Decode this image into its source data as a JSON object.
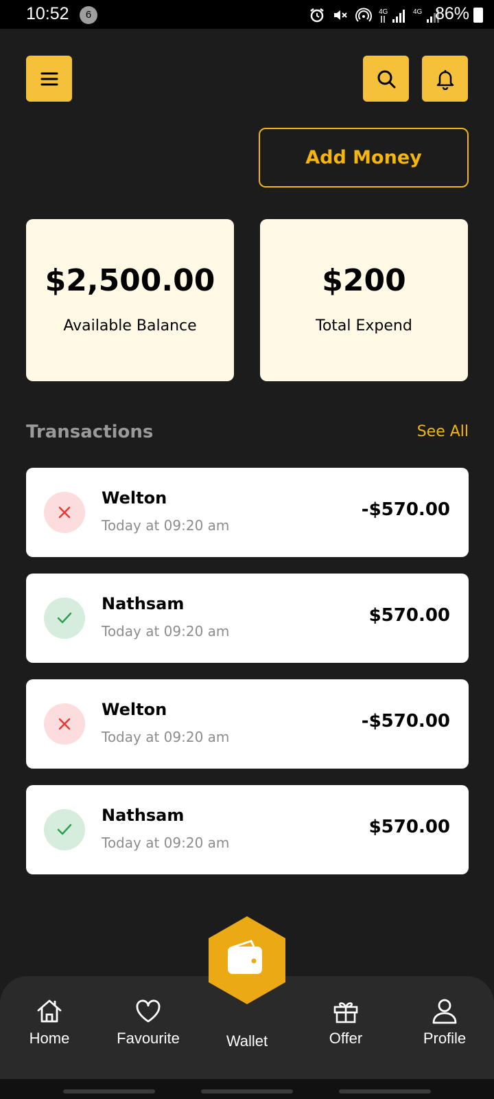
{
  "status_bar": {
    "time": "10:52",
    "notification_count": "6",
    "battery": "86%"
  },
  "header": {
    "menu_icon": "hamburger-menu-icon",
    "search_icon": "search-icon",
    "bell_icon": "bell-icon",
    "add_money_label": "Add Money"
  },
  "cards": [
    {
      "amount": "$2,500.00",
      "label": "Available Balance"
    },
    {
      "amount": "$200",
      "label": "Total Expend"
    }
  ],
  "transactions": {
    "heading": "Transactions",
    "see_all": "See All",
    "items": [
      {
        "name": "Welton",
        "time": "Today at 09:20 am",
        "amount": "-$570.00",
        "status": "failed"
      },
      {
        "name": "Nathsam",
        "time": "Today at 09:20 am",
        "amount": "$570.00",
        "status": "success"
      },
      {
        "name": "Welton",
        "time": "Today at 09:20 am",
        "amount": "-$570.00",
        "status": "failed"
      },
      {
        "name": "Nathsam",
        "time": "Today at 09:20 am",
        "amount": "$570.00",
        "status": "success"
      }
    ]
  },
  "nav": {
    "items": [
      {
        "label": "Home",
        "icon": "home-icon"
      },
      {
        "label": "Favourite",
        "icon": "heart-icon"
      },
      {
        "label": "Wallet",
        "icon": "wallet-icon"
      },
      {
        "label": "Offer",
        "icon": "gift-icon"
      },
      {
        "label": "Profile",
        "icon": "user-icon"
      }
    ]
  },
  "colors": {
    "accent": "#f5c13b",
    "accent_text": "#f5b50f",
    "background": "#1c1c1c",
    "card_bg": "#fff9e6",
    "negative": "#e53935",
    "positive": "#2e9e4f"
  }
}
